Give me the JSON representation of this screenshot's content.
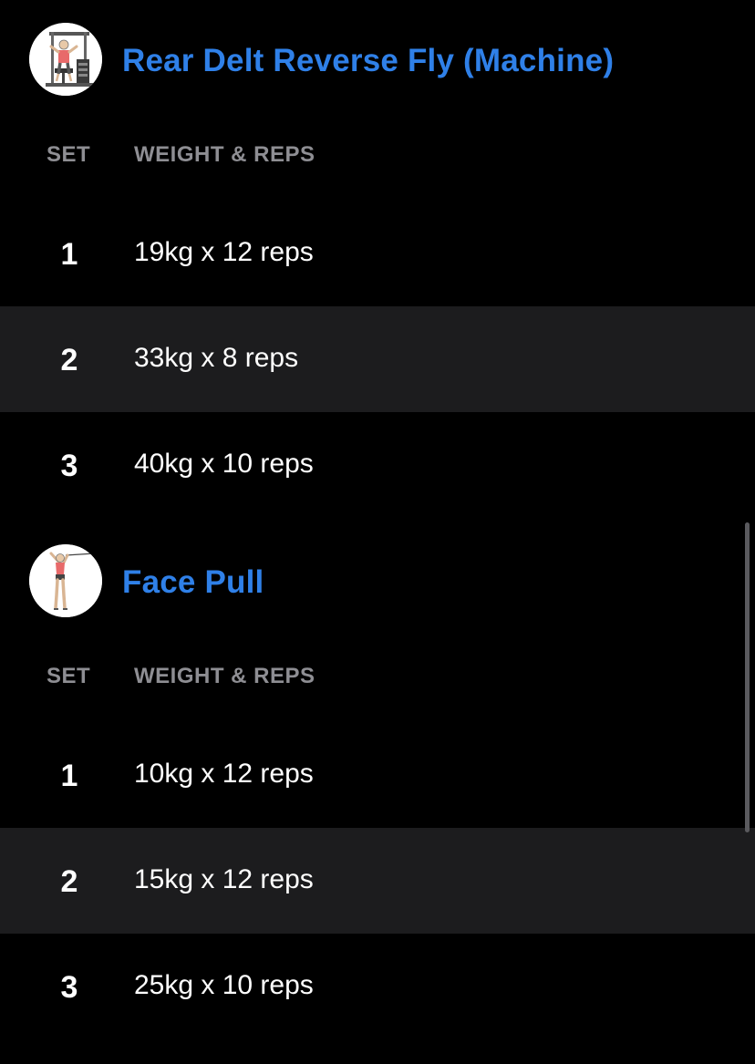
{
  "exercises": [
    {
      "title": "Rear Delt Reverse Fly (Machine)",
      "thumbnail_icon": "rear-delt-fly-machine-illustration",
      "columns": {
        "set": "SET",
        "weight_reps": "WEIGHT & REPS"
      },
      "sets": [
        {
          "number": "1",
          "value": "19kg x 12 reps"
        },
        {
          "number": "2",
          "value": "33kg x 8 reps"
        },
        {
          "number": "3",
          "value": "40kg x 10 reps"
        }
      ]
    },
    {
      "title": "Face Pull",
      "thumbnail_icon": "face-pull-illustration",
      "columns": {
        "set": "SET",
        "weight_reps": "WEIGHT & REPS"
      },
      "sets": [
        {
          "number": "1",
          "value": "10kg x 12 reps"
        },
        {
          "number": "2",
          "value": "15kg x 12 reps"
        },
        {
          "number": "3",
          "value": "25kg x 10 reps"
        }
      ]
    }
  ],
  "colors": {
    "background": "#000000",
    "title_accent": "#2f80e8",
    "header_text": "#8e8e93",
    "alt_row": "#1c1c1e",
    "text": "#ffffff"
  }
}
